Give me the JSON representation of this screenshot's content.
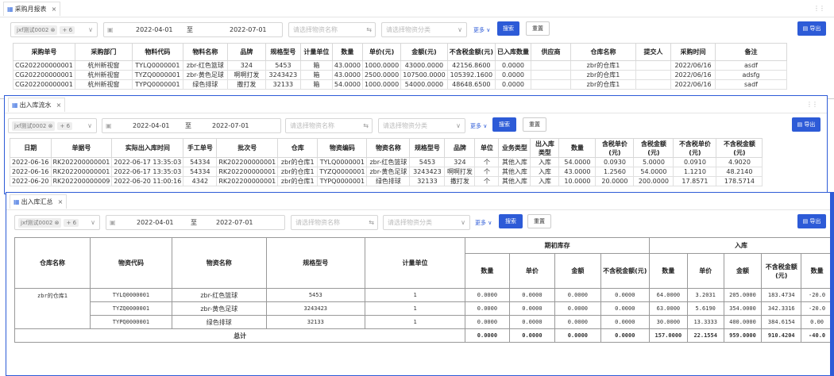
{
  "common": {
    "org_tag": "jxf测试0002",
    "org_tag_close": "⊗",
    "more_tag": "+ 6",
    "date_from": "2022-04-01",
    "date_to": "2022-07-01",
    "date_sep": "至",
    "goods_name_placeholder": "请选择物资名称",
    "goods_cat_placeholder": "请选择物资分类",
    "more_label": "更多 ∨",
    "search_label": "搜索",
    "reset_label": "重置",
    "export_label": "导出"
  },
  "p1": {
    "tab": "采购月报表",
    "headers": [
      "采购单号",
      "采购部门",
      "物料代码",
      "物料名称",
      "品牌",
      "规格型号",
      "计量单位",
      "数量",
      "单价(元)",
      "金额(元)",
      "不含税金额(元)",
      "已入库数量",
      "供应商",
      "仓库名称",
      "提交人",
      "采购时间",
      "备注"
    ],
    "rows": [
      [
        "CG202200000001",
        "杭州新视窗",
        "TYLQ0000001",
        "zbr-红色篮球",
        "324",
        "5453",
        "箱",
        "43.0000",
        "1000.0000",
        "43000.0000",
        "42156.8600",
        "0.0000",
        "",
        "zbr的仓库1",
        "",
        "2022/06/16",
        "asdf"
      ],
      [
        "CG202200000001",
        "杭州新视窗",
        "TYZQ0000001",
        "zbr-黄色足球",
        "啊啊打发",
        "3243423",
        "箱",
        "43.0000",
        "2500.0000",
        "107500.0000",
        "105392.1600",
        "0.0000",
        "",
        "zbr的仓库1",
        "",
        "2022/06/16",
        "adsfg"
      ],
      [
        "CG202200000001",
        "杭州新视窗",
        "TYPQ0000001",
        "绿色排球",
        "撒打发",
        "32133",
        "箱",
        "54.0000",
        "1000.0000",
        "54000.0000",
        "48648.6500",
        "0.0000",
        "",
        "zbr的仓库1",
        "",
        "2022/06/16",
        "sadf"
      ]
    ]
  },
  "p2": {
    "tab": "出入库流水",
    "headers": [
      "日期",
      "单据号",
      "实际出入库时间",
      "手工单号",
      "批次号",
      "仓库",
      "物资编码",
      "物资名称",
      "规格型号",
      "品牌",
      "单位",
      "业务类型",
      "出入库类型",
      "数量",
      "含税单价(元)",
      "含税金额(元)",
      "不含税单价(元)",
      "不含税金额(元)"
    ],
    "rows": [
      [
        "2022-06-16",
        "RK202200000001",
        "2022-06-17 13:35:03",
        "54334",
        "RK202200000001",
        "zbr的仓库1",
        "TYLQ0000001",
        "zbr-红色篮球",
        "5453",
        "324",
        "个",
        "其他入库",
        "入库",
        "54.0000",
        "0.0930",
        "5.0000",
        "0.0910",
        "4.9020"
      ],
      [
        "2022-06-16",
        "RK202200000001",
        "2022-06-17 13:35:03",
        "54334",
        "RK202200000001",
        "zbr的仓库1",
        "TYZQ0000001",
        "zbr-黄色足球",
        "3243423",
        "啊啊打发",
        "个",
        "其他入库",
        "入库",
        "43.0000",
        "1.2560",
        "54.0000",
        "1.1210",
        "48.2140"
      ],
      [
        "2022-06-20",
        "RK202200000009",
        "2022-06-20 11:00:16",
        "4342",
        "RK202200000001",
        "zbr的仓库1",
        "TYPQ0000001",
        "绿色排球",
        "32133",
        "撒打发",
        "个",
        "其他入库",
        "入库",
        "10.0000",
        "20.0000",
        "200.0000",
        "17.8571",
        "178.5714"
      ]
    ]
  },
  "p3": {
    "tab": "出入库汇总",
    "h_warehouse": "仓库名称",
    "h_code": "物资代码",
    "h_name": "物资名称",
    "h_spec": "规格型号",
    "h_unit": "计量单位",
    "h_opening": "期初库存",
    "h_in": "入库",
    "sub_opening": [
      "数量",
      "单价",
      "金额",
      "不含税金额(元)"
    ],
    "sub_in": [
      "数量",
      "单价",
      "金额",
      "不含税金额(元)",
      "数量"
    ],
    "warehouse": "zbr的仓库1",
    "rows": [
      [
        "TYLQ0000001",
        "zbr-红色篮球",
        "5453",
        "1",
        "0.0000",
        "0.0000",
        "0.0000",
        "0.0000",
        "64.0000",
        "3.2031",
        "205.0000",
        "183.4734",
        "-20.0"
      ],
      [
        "TYZQ0000001",
        "zbr-黄色足球",
        "3243423",
        "1",
        "0.0000",
        "0.0000",
        "0.0000",
        "0.0000",
        "63.0000",
        "5.6190",
        "354.0000",
        "342.3316",
        "-20.0"
      ],
      [
        "TYPQ0000001",
        "绿色排球",
        "32133",
        "1",
        "0.0000",
        "0.0000",
        "0.0000",
        "0.0000",
        "30.0000",
        "13.3333",
        "400.0000",
        "384.6154",
        "0.00"
      ]
    ],
    "total_label": "总计",
    "total": [
      "0.0000",
      "0.0000",
      "0.0000",
      "0.0000",
      "157.0000",
      "22.1554",
      "959.0000",
      "910.4204",
      "-40.0"
    ]
  }
}
